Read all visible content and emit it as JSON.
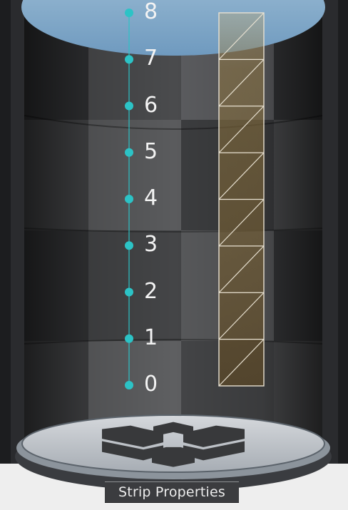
{
  "scene": {
    "tick_labels": [
      "8",
      "7",
      "6",
      "5",
      "4",
      "3",
      "2",
      "1",
      "0"
    ],
    "accent_color": "#2cc3c6",
    "strip_color": "#a1894d",
    "strip_segment_count": 8,
    "platform_logo": "unity-logo-icon"
  },
  "tooltip": {
    "label": "Strip Properties"
  }
}
